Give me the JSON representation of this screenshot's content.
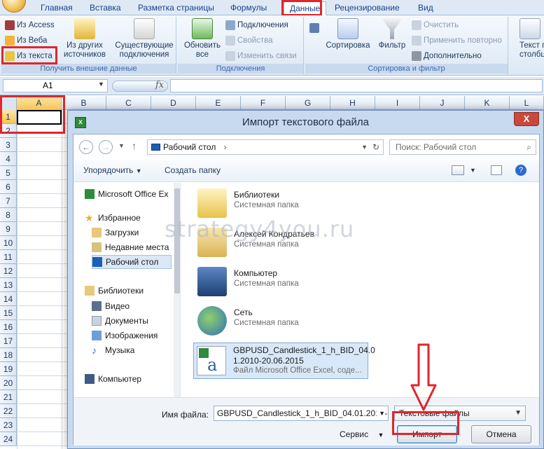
{
  "ribbon": {
    "tabs": [
      "Главная",
      "Вставка",
      "Разметка страницы",
      "Формулы",
      "Данные",
      "Рецензирование",
      "Вид"
    ],
    "active_tab": "Данные",
    "external": {
      "access": "Из Access",
      "web": "Из Веба",
      "text": "Из текста",
      "other_line1": "Из других",
      "other_line2": "источников",
      "existing_line1": "Существующие",
      "existing_line2": "подключения",
      "label": "Получить внешние данные"
    },
    "connections": {
      "refresh_line1": "Обновить",
      "refresh_line2": "все",
      "connections": "Подключения",
      "properties": "Свойства",
      "edit_links": "Изменить связи",
      "label": "Подключения"
    },
    "sort": {
      "sort": "Сортировка",
      "filter": "Фильтр",
      "clear": "Очистить",
      "reapply": "Применить повторно",
      "advanced": "Дополнительно",
      "label": "Сортировка и фильтр"
    },
    "text_cols_line1": "Текст п",
    "text_cols_line2": "столбц"
  },
  "formula_bar": {
    "name_box": "A1",
    "fx": "fx"
  },
  "grid": {
    "columns": [
      "A",
      "B",
      "C",
      "D",
      "E",
      "F",
      "G",
      "H",
      "I",
      "J",
      "K",
      "L"
    ],
    "rows": [
      "1",
      "2",
      "3",
      "4",
      "5",
      "6",
      "7",
      "8",
      "9",
      "10",
      "11",
      "12",
      "13",
      "14",
      "15",
      "16",
      "17",
      "18",
      "19",
      "20",
      "21",
      "22",
      "23",
      "24"
    ]
  },
  "dialog": {
    "title": "Импорт текстового файла",
    "close": "X",
    "address": "Рабочий стол",
    "search_placeholder": "Поиск: Рабочий стол",
    "organize": "Упорядочить",
    "new_folder": "Создать папку",
    "nav": [
      "Microsoft Office Ex",
      "Избранное",
      "Загрузки",
      "Недавние места",
      "Рабочий стол",
      "Библиотеки",
      "Видео",
      "Документы",
      "Изображения",
      "Музыка",
      "Компьютер"
    ],
    "files": [
      {
        "name": "Библиотеки",
        "type": "Системная папка"
      },
      {
        "name": "Алексей Кондратьев",
        "type": "Системная папка"
      },
      {
        "name": "Компьютер",
        "type": "Системная папка"
      },
      {
        "name": "Сеть",
        "type": "Системная папка"
      }
    ],
    "selected_file": {
      "line1": "GBPUSD_Candlestick_1_h_BID_04.0",
      "line2": "1.2010-20.06.2015",
      "line3": "Файл Microsoft Office Excel, соде..."
    },
    "filename_label": "Имя файла:",
    "filename_value": "GBPUSD_Candlestick_1_h_BID_04.01.2010-2",
    "filetype": "Текстовые файлы",
    "service": "Сервис",
    "import": "Импорт",
    "cancel": "Отмена"
  },
  "watermark": "strategy4you.ru",
  "colors": {
    "highlight_red": "#e0262c",
    "ribbon_blue": "#dfe9f5"
  }
}
